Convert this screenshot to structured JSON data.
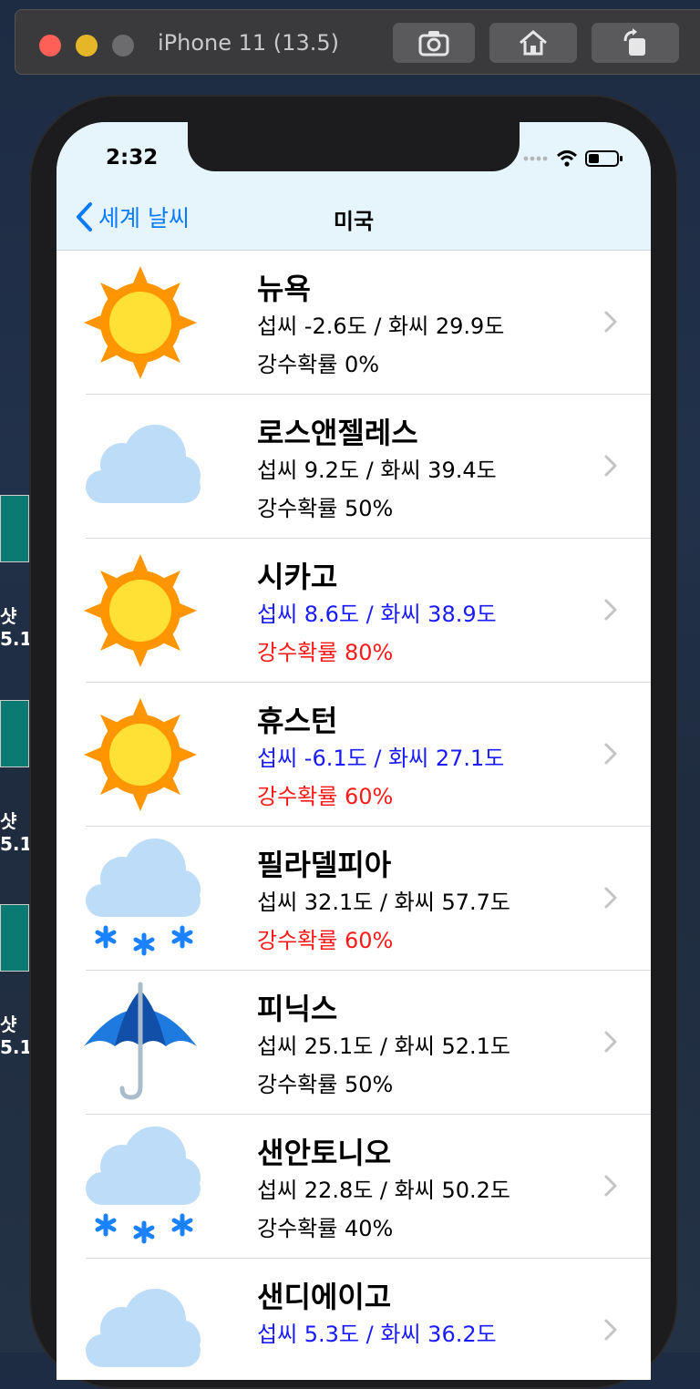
{
  "simulator": {
    "title": "iPhone 11 (13.5)",
    "buttons": [
      "screenshot",
      "home",
      "rotate"
    ]
  },
  "status_bar": {
    "time": "2:32"
  },
  "nav": {
    "back_label": "세계 날씨",
    "title": "미국"
  },
  "colors": {
    "accent": "#0a7bff",
    "temp_normal": "#000000",
    "temp_highlight": "#1a1aff",
    "rain_normal": "#000000",
    "rain_highlight": "#ff1a1a"
  },
  "cities": [
    {
      "name": "뉴욕",
      "temp": "섭씨 -2.6도 / 화씨 29.9도",
      "rain": "강수확률 0%",
      "icon": "sun-icon",
      "temp_color": "#000000",
      "rain_color": "#000000"
    },
    {
      "name": "로스앤젤레스",
      "temp": "섭씨 9.2도 / 화씨 39.4도",
      "rain": "강수확률 50%",
      "icon": "cloud-icon",
      "temp_color": "#000000",
      "rain_color": "#000000"
    },
    {
      "name": "시카고",
      "temp": "섭씨 8.6도 / 화씨 38.9도",
      "rain": "강수확률 80%",
      "icon": "sun-icon",
      "temp_color": "#1a1aff",
      "rain_color": "#ff1a1a"
    },
    {
      "name": "휴스턴",
      "temp": "섭씨 -6.1도 / 화씨 27.1도",
      "rain": "강수확률 60%",
      "icon": "sun-icon",
      "temp_color": "#1a1aff",
      "rain_color": "#ff1a1a"
    },
    {
      "name": "필라델피아",
      "temp": "섭씨 32.1도 / 화씨 57.7도",
      "rain": "강수확률 60%",
      "icon": "snow-icon",
      "temp_color": "#000000",
      "rain_color": "#ff1a1a"
    },
    {
      "name": "피닉스",
      "temp": "섭씨 25.1도 / 화씨 52.1도",
      "rain": "강수확률 50%",
      "icon": "umbrella-icon",
      "temp_color": "#000000",
      "rain_color": "#000000"
    },
    {
      "name": "샌안토니오",
      "temp": "섭씨 22.8도 / 화씨 50.2도",
      "rain": "강수확률 40%",
      "icon": "snow-icon",
      "temp_color": "#000000",
      "rain_color": "#000000"
    },
    {
      "name": "샌디에이고",
      "temp": "섭씨 5.3도 / 화씨 36.2도",
      "rain": "",
      "icon": "cloud-icon",
      "temp_color": "#1a1aff",
      "rain_color": "#000000"
    }
  ]
}
